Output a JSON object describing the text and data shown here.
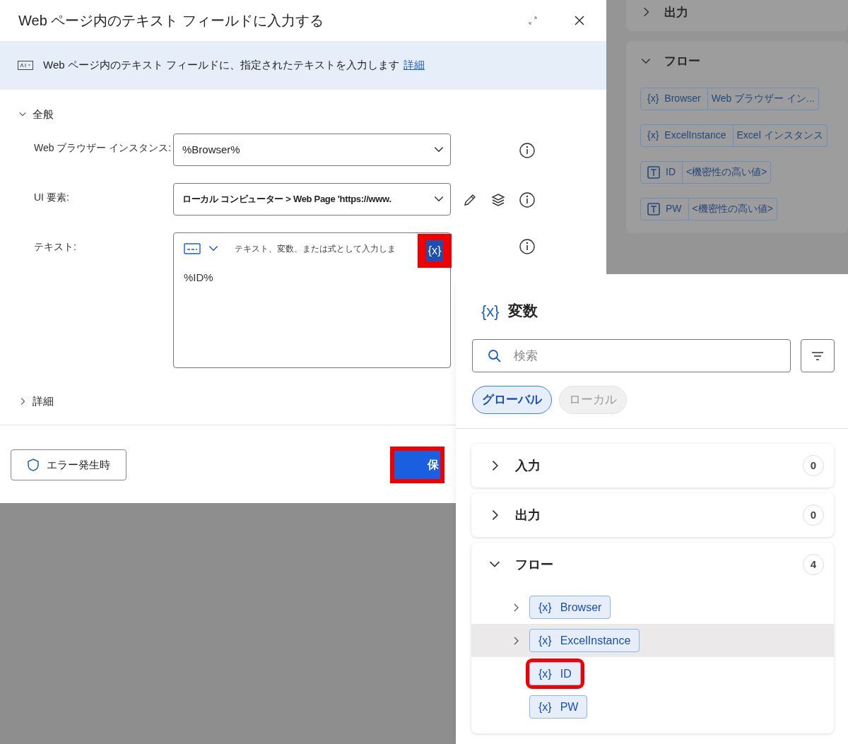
{
  "background_pane": {
    "sections": [
      {
        "label": "出力",
        "expanded": false
      },
      {
        "label": "フロー",
        "expanded": true,
        "variables": [
          {
            "kind": "object",
            "icon_text": "{x}",
            "name": "Browser",
            "value": "Web ブラウザー イン..."
          },
          {
            "kind": "object",
            "icon_text": "{x}",
            "name": "ExcelInstance",
            "value": "Excel インスタンス"
          },
          {
            "kind": "text",
            "name": "ID",
            "value": "<機密性の高い値>"
          },
          {
            "kind": "text",
            "name": "PW",
            "value": "<機密性の高い値>"
          }
        ]
      }
    ]
  },
  "dialog": {
    "title": "Web ページ内のテキスト フィールドに入力する",
    "description": "Web ページ内のテキスト フィールドに、指定されたテキストを入力します",
    "description_link": "詳細",
    "general_section": {
      "label": "全般",
      "expanded": true
    },
    "fields": [
      {
        "kind": "dropdown",
        "label": "Web ブラウザー インスタンス:",
        "value": "%Browser%",
        "bold": false,
        "editable": false
      },
      {
        "kind": "dropdown",
        "label": "UI 要素:",
        "value": "ローカル コンピューター > Web Page 'https://www.",
        "bold": true,
        "editable": true
      },
      {
        "kind": "text",
        "label": "テキスト:",
        "placeholder": "テキスト、変数、または式として入力しま",
        "value": "%ID%",
        "variable_button": "{x}",
        "variable_button_highlighted": true
      }
    ],
    "advanced_section": {
      "label": "詳細",
      "expanded": false
    },
    "error_button": "エラー発生時",
    "save_button": {
      "label": "保",
      "highlighted": true
    }
  },
  "variables_popup": {
    "icon_text": "{x}",
    "title": "変数",
    "search": {
      "placeholder": "検索"
    },
    "scopes": [
      {
        "label": "グローバル",
        "selected": true
      },
      {
        "label": "ローカル",
        "selected": false
      }
    ],
    "groups": [
      {
        "label": "入力",
        "count": "0",
        "expanded": false
      },
      {
        "label": "出力",
        "count": "0",
        "expanded": false
      },
      {
        "label": "フロー",
        "count": "4",
        "expanded": true,
        "children": [
          {
            "icon_text": "{x}",
            "name": "Browser",
            "has_children": true,
            "hovered": false,
            "highlighted": false
          },
          {
            "icon_text": "{x}",
            "name": "ExcelInstance",
            "has_children": true,
            "hovered": true,
            "highlighted": false
          },
          {
            "icon_text": "{x}",
            "name": "ID",
            "has_children": false,
            "hovered": false,
            "highlighted": true
          },
          {
            "icon_text": "{x}",
            "name": "PW",
            "has_children": false,
            "hovered": false,
            "highlighted": false
          }
        ]
      }
    ]
  }
}
